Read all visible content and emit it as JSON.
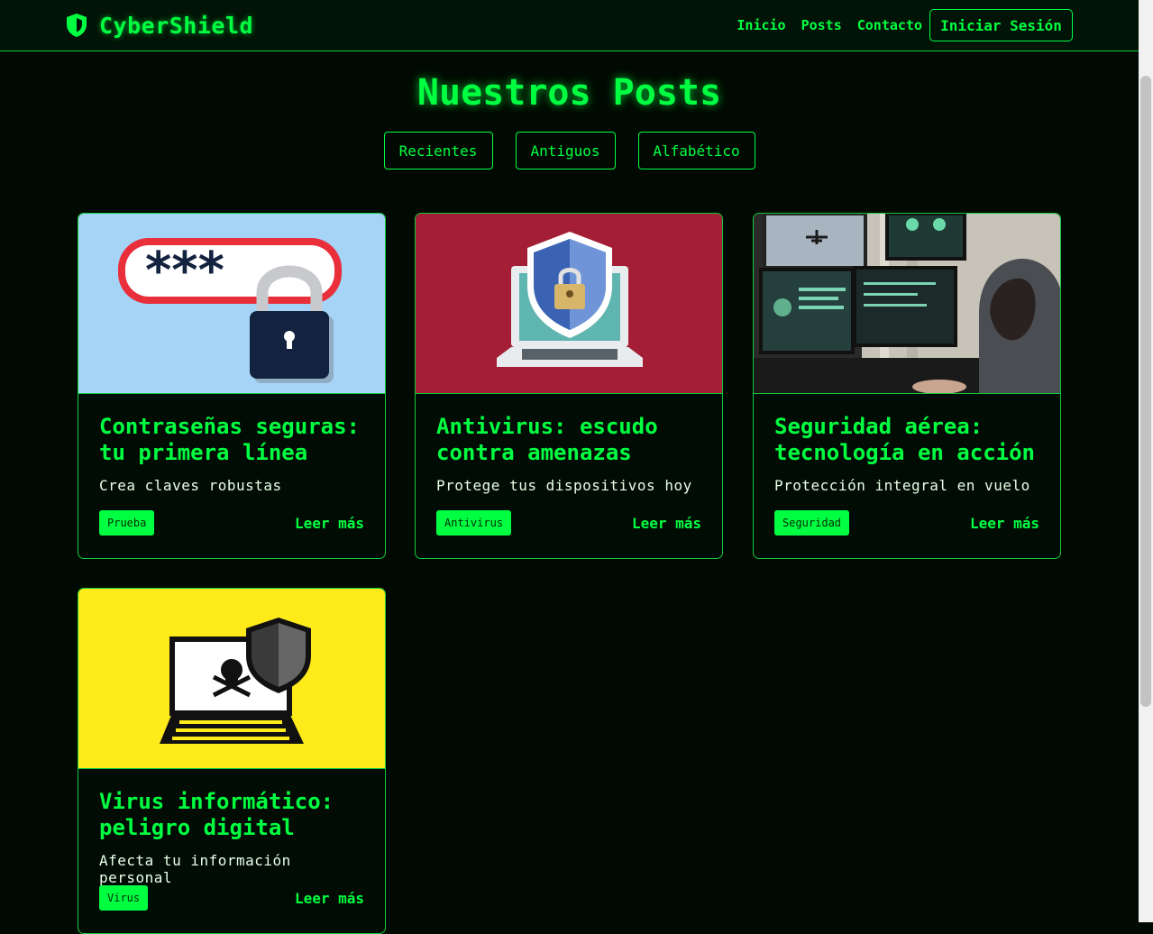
{
  "colors": {
    "accent": "#00ff41",
    "background": "#010a02"
  },
  "nav": {
    "brand": "CyberShield",
    "brand_icon": "shield-icon",
    "links": [
      "Inicio",
      "Posts",
      "Contacto"
    ],
    "login_label": "Iniciar Sesión"
  },
  "page": {
    "title": "Nuestros Posts"
  },
  "sort": {
    "buttons": [
      "Recientes",
      "Antiguos",
      "Alfabético"
    ]
  },
  "posts": [
    {
      "title": "Contraseñas seguras: tu primera línea",
      "description": "Crea claves robustas",
      "tag": "Prueba",
      "link": "Leer más",
      "image": "password-lock-illustration"
    },
    {
      "title": "Antivirus: escudo contra amenazas",
      "description": "Protege tus dispositivos hoy",
      "tag": "Antivirus",
      "link": "Leer más",
      "image": "laptop-shield-illustration"
    },
    {
      "title": "Seguridad aérea: tecnología en acción",
      "description": "Protección integral en vuelo",
      "tag": "Seguridad",
      "link": "Leer más",
      "image": "hacker-monitors-photo"
    },
    {
      "title": "Virus informático: peligro digital",
      "description": "Afecta tu información personal",
      "tag": "Virus",
      "link": "Leer más",
      "image": "virus-laptop-illustration"
    }
  ]
}
